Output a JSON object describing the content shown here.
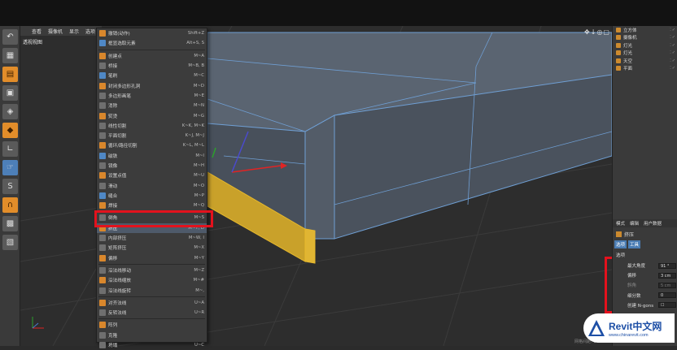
{
  "viewport": {
    "menu": [
      "查看",
      "摄像机",
      "显示",
      "选项"
    ],
    "label": "透视视图",
    "icons": "✥↓◎▢",
    "bottom_info": "网格间距: 100 cm"
  },
  "context_menu": {
    "items": [
      {
        "label": "撤销(动作)",
        "shortcut": "Shift+Z"
      },
      {
        "label": "框显选取元素",
        "shortcut": "Alt+S, S"
      },
      {
        "sep": true
      },
      {
        "label": "创建点",
        "shortcut": "M~A"
      },
      {
        "label": "桥接",
        "shortcut": "M~B, B"
      },
      {
        "label": "笔刷",
        "shortcut": "M~C"
      },
      {
        "label": "封闭多边形孔洞",
        "shortcut": "M~D"
      },
      {
        "label": "多边形画笔",
        "shortcut": "M~E"
      },
      {
        "label": "消除",
        "shortcut": "M~N"
      },
      {
        "label": "熨烫",
        "shortcut": "M~G"
      },
      {
        "label": "线性切割",
        "shortcut": "K~K, M~K"
      },
      {
        "label": "平面切割",
        "shortcut": "K~J, M~J"
      },
      {
        "label": "循环/路径切割",
        "shortcut": "K~L, M~L"
      },
      {
        "label": "磁铁",
        "shortcut": "M~I"
      },
      {
        "label": "镜像",
        "shortcut": "M~H"
      },
      {
        "label": "设置点值",
        "shortcut": "M~U"
      },
      {
        "label": "滑动",
        "shortcut": "M~O"
      },
      {
        "label": "缝合",
        "shortcut": "M~P"
      },
      {
        "label": "焊接",
        "shortcut": "M~Q"
      },
      {
        "sep": true
      },
      {
        "label": "倒角",
        "shortcut": "M~S"
      },
      {
        "label": "挤压",
        "shortcut": "M~T, D",
        "highlight": true
      },
      {
        "label": "内部挤压",
        "shortcut": "M~W, I"
      },
      {
        "label": "矩阵挤压",
        "shortcut": "M~X"
      },
      {
        "label": "偏移",
        "shortcut": "M~Y"
      },
      {
        "sep": true
      },
      {
        "label": "沿法线移动",
        "shortcut": "M~Z"
      },
      {
        "label": "沿法线缩放",
        "shortcut": "M~#"
      },
      {
        "label": "沿法线旋转",
        "shortcut": "M~,"
      },
      {
        "sep": true
      },
      {
        "label": "对齐法线",
        "shortcut": "U~A"
      },
      {
        "label": "反转法线",
        "shortcut": "U~R"
      },
      {
        "sep": true
      },
      {
        "label": "阵列",
        "shortcut": ""
      },
      {
        "label": "克隆",
        "shortcut": ""
      },
      {
        "label": "坍塌",
        "shortcut": "U~C"
      }
    ]
  },
  "objects": [
    {
      "name": "立方体"
    },
    {
      "name": "摄像机"
    },
    {
      "name": "灯光"
    },
    {
      "name": "灯光"
    },
    {
      "name": "天空"
    },
    {
      "name": "平面"
    }
  ],
  "object_flags": "⁚✓",
  "attributes": {
    "tabs": [
      "模式",
      "编辑",
      "用户数据"
    ],
    "title": "挤压",
    "subtabs": [
      "选项",
      "工具"
    ],
    "section": "选项",
    "params": [
      {
        "label": "最大角度",
        "value": "91 °"
      },
      {
        "label": "偏移",
        "value": "3 cm"
      },
      {
        "label": "斜角",
        "value": "5 cm",
        "dim": true
      },
      {
        "label": "细分数",
        "value": "0"
      },
      {
        "label": "创建 N-gons",
        "value": "☐",
        "dim": false
      }
    ]
  },
  "watermark": {
    "brand": "Revit中文网",
    "url": "www.chinarevit.com"
  },
  "colors": {
    "highlight_box": "#e3121d",
    "wire": "#6f9fd4",
    "selection": "#e8b92b"
  }
}
